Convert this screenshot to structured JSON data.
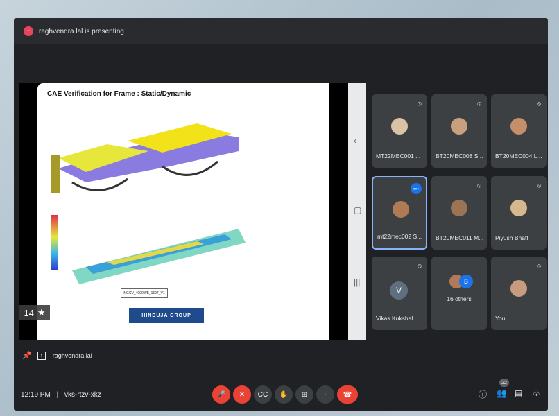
{
  "topbar": {
    "presenting_text": "raghvendra lal is presenting",
    "avatar_initial": "r"
  },
  "slide": {
    "title": "CAE Verification for Frame : Static/Dynamic",
    "label_box": "NGCV_4900WB_1697_V1",
    "logo_text": "HINDUJA GROUP",
    "counter": "14",
    "counter_icon": "pin-icon"
  },
  "tiles": [
    {
      "name": "MT22MEC001 ...",
      "mic": "muted",
      "avatar_color": "#d9c2a5"
    },
    {
      "name": "BT20MEC008 S...",
      "mic": "muted",
      "avatar_color": "#c9a07e"
    },
    {
      "name": "BT20MEC004 L...",
      "mic": "muted",
      "avatar_color": "#c48f6a"
    },
    {
      "name": "mt22mec002 S...",
      "mic": "active",
      "avatar_color": "#b07a55"
    },
    {
      "name": "BT20MEC011 M...",
      "mic": "muted",
      "avatar_color": "#9a7455"
    },
    {
      "name": "Piyush Bhatt",
      "mic": "muted",
      "avatar_color": "#d4b98e"
    },
    {
      "name": "Vikas Kukshal",
      "mic": "muted",
      "avatar_letter": "V"
    },
    {
      "name": "16 others",
      "mic": "none",
      "second_initial": "B"
    },
    {
      "name": "You",
      "mic": "muted",
      "avatar_color": "#c89b80"
    }
  ],
  "presenter": {
    "name": "raghvendra lal"
  },
  "bottombar": {
    "time": "12:19 PM",
    "separator": "|",
    "meeting_code": "vks-rtzv-xkz",
    "participants_count": "22",
    "controls": [
      "mic-off-icon",
      "camera-off-icon",
      "captions-icon",
      "raise-hand-icon",
      "present-icon",
      "more-icon",
      "end-call-icon"
    ],
    "right_icons": [
      "info-icon",
      "people-icon",
      "chat-icon",
      "activities-icon"
    ]
  },
  "colors": {
    "accent": "#1a73e8",
    "danger": "#ea4335",
    "bg": "#202124",
    "tile": "#3c4043"
  }
}
